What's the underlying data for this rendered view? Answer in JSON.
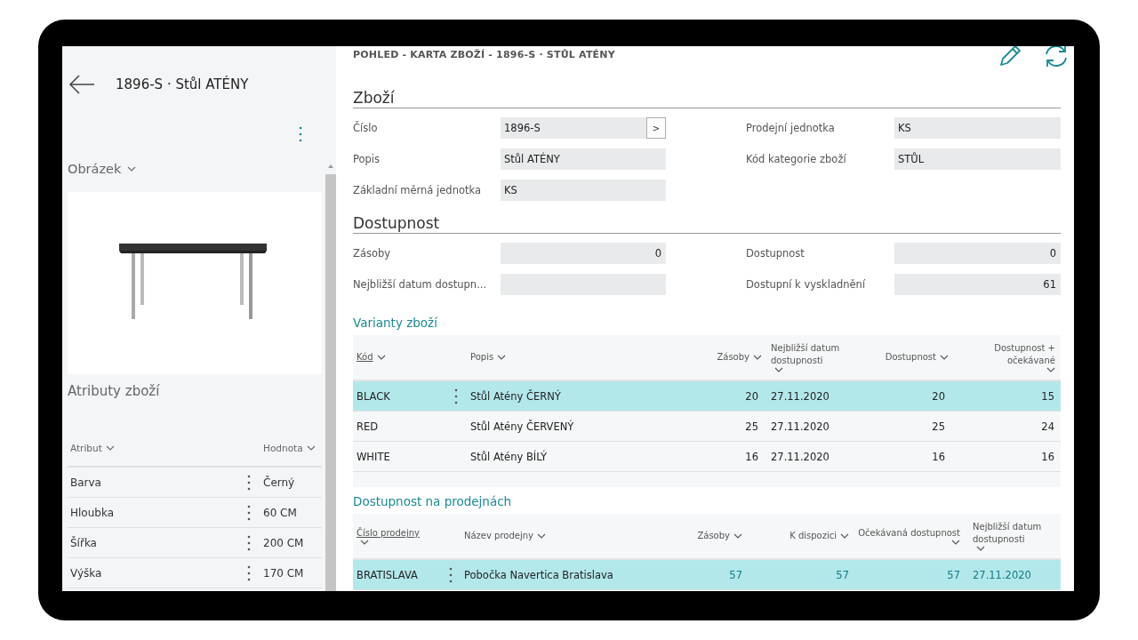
{
  "sidebar": {
    "back_title": "1896-S · Stůl ATÉNY",
    "picture_section": "Obrázek",
    "attributes_title": "Atributy zboží",
    "attribute_columns": [
      "Atribut",
      "Hodnota"
    ],
    "attributes": [
      {
        "name": "Barva",
        "value": "Černý"
      },
      {
        "name": "Hloubka",
        "value": "60 CM"
      },
      {
        "name": "Šířka",
        "value": "200 CM"
      },
      {
        "name": "Výška",
        "value": "170 CM"
      }
    ]
  },
  "breadcrumb": "POHLED - KARTA ZBOŽÍ - 1896-S · STŮL ATÉNY",
  "sections": [
    {
      "title": "Zboží",
      "left": [
        {
          "label": "Číslo",
          "value": "1896-S",
          "kind": "text",
          "lookup": ">"
        },
        {
          "label": "Popis",
          "value": "Stůl ATÉNY",
          "kind": "text"
        },
        {
          "label": "Základní měrná jednotka",
          "value": "KS",
          "kind": "text"
        }
      ],
      "right": [
        {
          "label": "Prodejní jednotka",
          "value": "KS",
          "kind": "text"
        },
        {
          "label": "Kód kategorie zboží",
          "value": "STŮL",
          "kind": "text"
        }
      ]
    },
    {
      "title": "Dostupnost",
      "left": [
        {
          "label": "Zásoby",
          "value": "0",
          "kind": "number"
        },
        {
          "label": "Nejbližší datum dostupn...",
          "kind": "text"
        }
      ],
      "right": [
        {
          "label": "Dostupnost",
          "value": "0",
          "kind": "number"
        },
        {
          "label": "Dostupní k vyskladnění",
          "value": "61",
          "kind": "number"
        }
      ]
    }
  ],
  "tables": [
    {
      "title": "Varianty zboží",
      "columns": [
        {
          "label": "Kód",
          "kind": "text",
          "sorted": true
        },
        {
          "label": "Popis",
          "kind": "text",
          "sorted": false
        },
        {
          "label": "Zásoby",
          "kind": "number",
          "sorted": false
        },
        {
          "label": "Nejbližší datum dostupnosti",
          "kind": "text",
          "sorted": false
        },
        {
          "label": "Dostupnost",
          "kind": "number",
          "sorted": false
        },
        {
          "label": "Dostupnost + očekávané",
          "kind": "number",
          "sorted": false
        }
      ],
      "rows": [
        {
          "selected": true,
          "cells": [
            "BLACK",
            "Stůl Atény ČERNÝ",
            "20",
            "27.11.2020",
            "20",
            "15"
          ]
        },
        {
          "selected": false,
          "cells": [
            "RED",
            "Stůl Atény ČERVENÝ",
            "25",
            "27.11.2020",
            "25",
            "24"
          ]
        },
        {
          "selected": false,
          "cells": [
            "WHITE",
            "Stůl Atény BÍLÝ",
            "16",
            "27.11.2020",
            "16",
            "16"
          ]
        }
      ]
    },
    {
      "title": "Dostupnost na prodejnách",
      "columns": [
        {
          "label": "Číslo prodejny",
          "kind": "text",
          "sorted": true
        },
        {
          "label": "Název prodejny",
          "kind": "text",
          "sorted": false
        },
        {
          "label": "Zásoby",
          "kind": "link",
          "sorted": false
        },
        {
          "label": "K dispozici",
          "kind": "link",
          "sorted": false
        },
        {
          "label": "Očekávaná dostupnost",
          "kind": "link",
          "sorted": false
        },
        {
          "label": "Nejbližší datum dostupnosti",
          "kind": "linkdate",
          "sorted": false
        }
      ],
      "rows": [
        {
          "selected": true,
          "cells": [
            "BRATISLAVA",
            "Pobočka Navertica Bratislava",
            "57",
            "57",
            "57",
            "27.11.2020"
          ]
        }
      ]
    }
  ]
}
